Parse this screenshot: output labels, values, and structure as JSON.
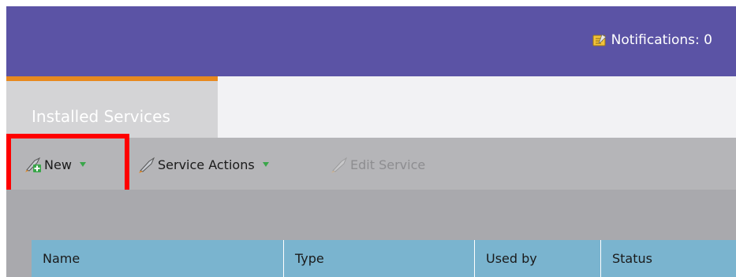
{
  "header": {
    "notifications_label": "Notifications: 0",
    "notifications_icon": "notepad-icon"
  },
  "tabs": [
    {
      "label": "Installed Services",
      "active": true
    }
  ],
  "toolbar": {
    "new_label": "New",
    "service_actions_label": "Service Actions",
    "edit_service_label": "Edit Service"
  },
  "table": {
    "columns": [
      "Name",
      "Type",
      "Used by",
      "Status"
    ]
  },
  "colors": {
    "header_bg": "#5b53a5",
    "tab_accent": "#e8891e",
    "highlight": "#ff0000",
    "table_header_bg": "#7ab4cf"
  }
}
